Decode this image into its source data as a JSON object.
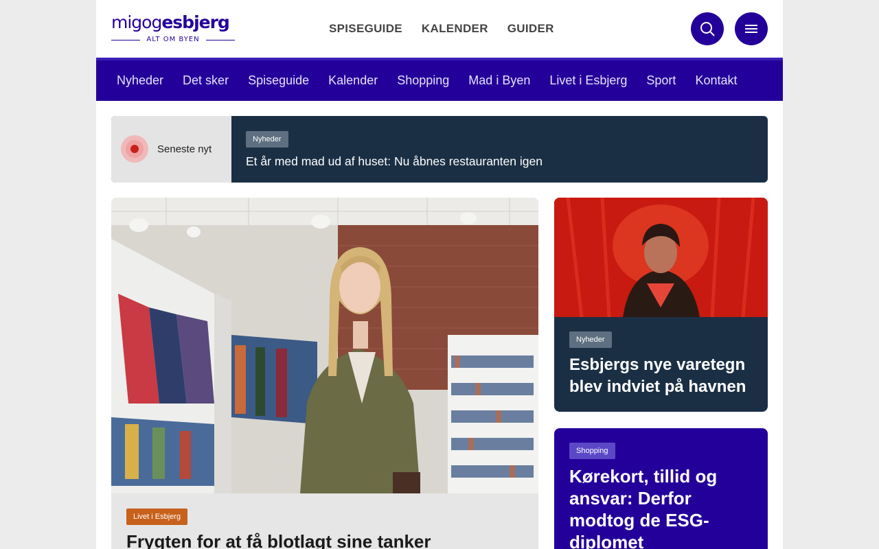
{
  "logo": {
    "word_light": "migog",
    "word_bold": "esbjerg",
    "tagline": "ALT OM BYEN"
  },
  "topnav": [
    "SPISEGUIDE",
    "KALENDER",
    "GUIDER"
  ],
  "header_buttons": {
    "search_icon": "search-icon",
    "menu_icon": "hamburger-menu-icon"
  },
  "mainnav": [
    "Nyheder",
    "Det sker",
    "Spiseguide",
    "Kalender",
    "Shopping",
    "Mad i Byen",
    "Livet i Esbjerg",
    "Sport",
    "Kontakt"
  ],
  "ticker": {
    "label": "Seneste nyt",
    "tag": "Nyheder",
    "title": "Et år med mad ud af huset: Nu åbnes restauranten igen"
  },
  "main_article": {
    "tag": "Livet i Esbjerg",
    "title": "Frygten for at få blotlagt sine tanker"
  },
  "side_articles": [
    {
      "tag": "Nyheder",
      "title": "Esbjergs nye varetegn blev indviet på havnen"
    },
    {
      "tag": "Shopping",
      "title": "Kørekort, tillid og ansvar: Derfor modtog de ESG-diplomet"
    }
  ],
  "colors": {
    "brand": "#24009a",
    "ticker_dark": "#1b2f44",
    "tag_grey": "#5d6f80",
    "tag_orange": "#c7611c",
    "tag_purple": "#5b48c6",
    "live_red": "#c8211d"
  }
}
